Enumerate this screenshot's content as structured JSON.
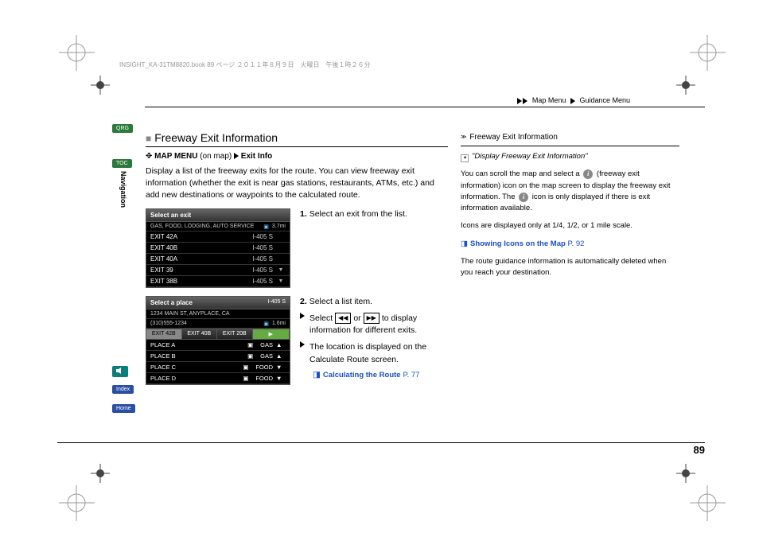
{
  "bookinfo": "INSIGHT_KA-31TM8820.book   89 ページ   ２０１１年８月９日　火曜日　午後１時２６分",
  "breadcrumb": {
    "a": "Map Menu",
    "b": "Guidance Menu"
  },
  "tabs": {
    "qrg": "QRG",
    "toc": "TOC",
    "audio": "",
    "index": "Index",
    "home": "Home"
  },
  "navlabel": "Navigation",
  "title": "Freeway Exit Information",
  "menu": {
    "a": "MAP MENU",
    "b": "(on map)",
    "c": "Exit Info"
  },
  "intro": "Display a list of the freeway exits for the route. You can view freeway exit information (whether the exit is near gas stations, restaurants, ATMs, etc.) and add new destinations or waypoints to the calculated route.",
  "s1": {
    "title": "Select an exit",
    "sub": "GAS, FOOD, LODGING, AUTO SERVICE",
    "dist": "3.7mi",
    "rows": [
      {
        "e": "EXIT 42A",
        "h": "I-405 S",
        "i": ""
      },
      {
        "e": "EXIT 40B",
        "h": "I-405 S",
        "i": ""
      },
      {
        "e": "EXIT 40A",
        "h": "I-405 S",
        "i": ""
      },
      {
        "e": "EXIT 39",
        "h": "I-405 S",
        "i": "▼"
      },
      {
        "e": "EXIT 38B",
        "h": "I-405 S",
        "i": "▼"
      }
    ]
  },
  "step1": "Select an exit from the list.",
  "s2": {
    "title": "Select a place",
    "hdr_r": "I-405 S",
    "addr": "1234 MAIN ST, ANYPLACE, CA",
    "phone": "(310)555-1234",
    "dist": "1.6mi",
    "tabs": [
      "EXIT 42B",
      "EXIT 40B",
      "EXIT 20B"
    ],
    "rows": [
      {
        "p": "PLACE A",
        "c": "GAS",
        "i": "▲"
      },
      {
        "p": "PLACE B",
        "c": "GAS",
        "i": "▲"
      },
      {
        "p": "PLACE C",
        "c": "FOOD",
        "i": "▼"
      },
      {
        "p": "PLACE D",
        "c": "FOOD",
        "i": "▼"
      }
    ]
  },
  "step2": "Select a list item.",
  "step2a_pre": "Select ",
  "step2a_mid": " or ",
  "step2a_post": " to display information for different exits.",
  "step2b": "The location is displayed on the Calculate Route screen.",
  "link1": "Calculating the Route",
  "link1_page": "P. 77",
  "side": {
    "title": "Freeway Exit Information",
    "voice": "\"Display Freeway Exit Information\"",
    "p1a": "You can scroll the map and select a ",
    "p1b": " (freeway exit information) icon on the map screen to display the freeway exit information. The ",
    "p1c": " icon is only displayed if there is exit information available.",
    "p2": "Icons are displayed only at 1/4, 1/2, or 1 mile scale.",
    "link": "Showing Icons on the Map",
    "link_page": "P. 92",
    "p3": "The route guidance information is automatically deleted when you reach your destination."
  },
  "info_i": "i",
  "pagenum": "89"
}
